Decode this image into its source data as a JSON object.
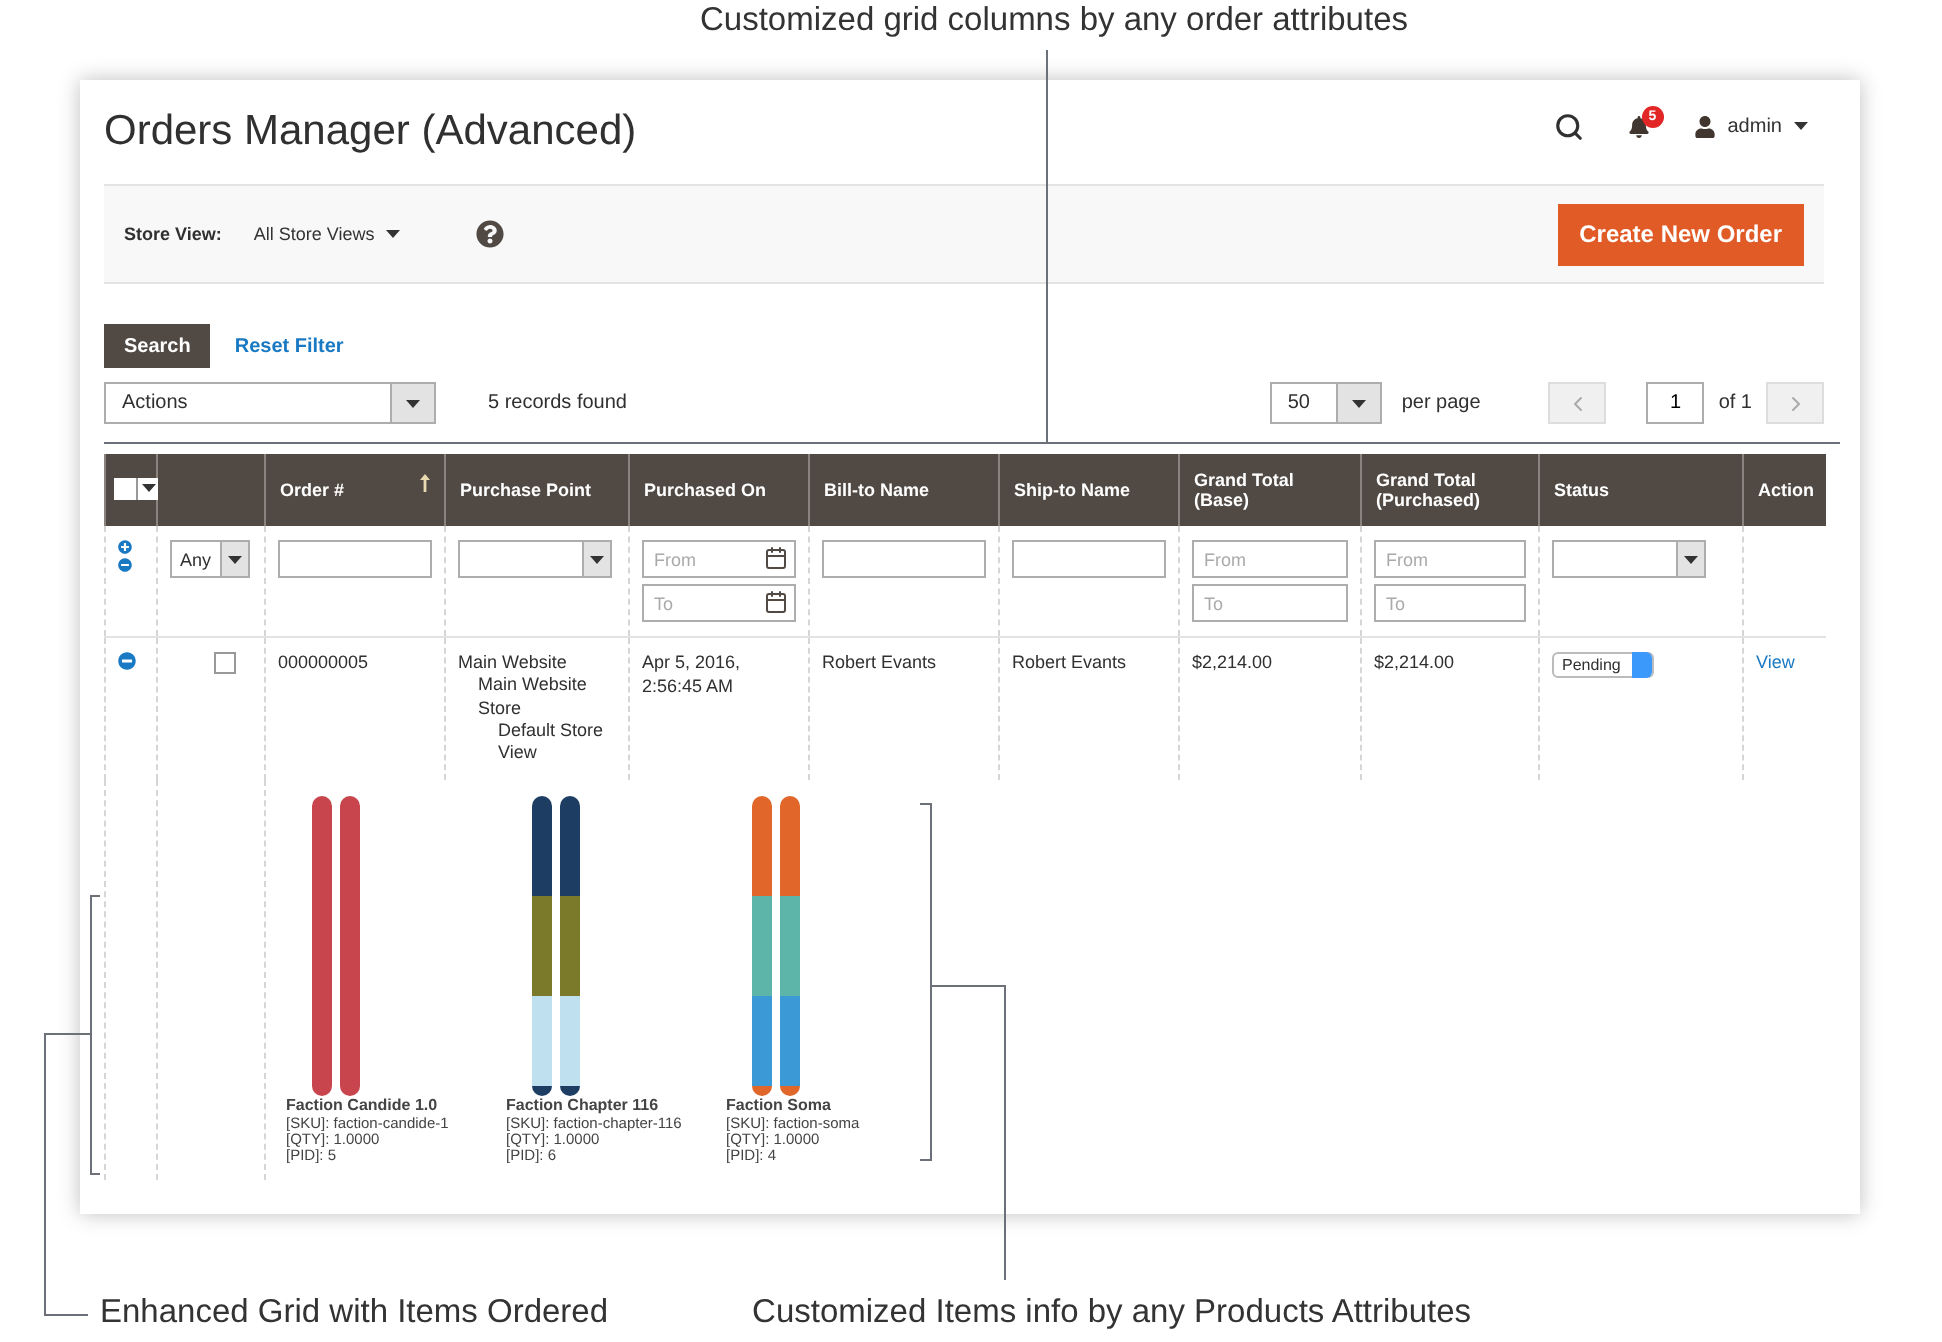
{
  "annotations": {
    "top": "Customized grid columns by any order attributes",
    "bottom_left": "Enhanced Grid with Items Ordered",
    "bottom_right": "Customized Items info by any Products Attributes"
  },
  "header": {
    "title": "Orders Manager (Advanced)",
    "notification_count": "5",
    "user": "admin"
  },
  "store_view": {
    "label": "Store View:",
    "value": "All Store Views"
  },
  "create_button": "Create New Order",
  "search_button": "Search",
  "reset_link": "Reset Filter",
  "actions_select": "Actions",
  "records": "5 records found",
  "pagination": {
    "per_page_value": "50",
    "per_page_label": "per page",
    "page": "1",
    "of": "of 1"
  },
  "table": {
    "columns": [
      {
        "kind": "mass"
      },
      {
        "kind": "blank"
      },
      {
        "kind": "text",
        "label": "Order #",
        "sorted": true
      },
      {
        "kind": "text",
        "label": "Purchase Point",
        "sorted": false
      },
      {
        "kind": "text",
        "label": "Purchased On",
        "sorted": false
      },
      {
        "kind": "text",
        "label": "Bill-to Name",
        "sorted": false
      },
      {
        "kind": "text",
        "label": "Ship-to Name",
        "sorted": false
      },
      {
        "kind": "text",
        "label": "Grand Total (Base)",
        "sorted": false
      },
      {
        "kind": "text",
        "label": "Grand Total (Purchased)",
        "sorted": false
      },
      {
        "kind": "text",
        "label": "Status",
        "sorted": false
      },
      {
        "kind": "text",
        "label": "Action",
        "sorted": false
      }
    ],
    "filters": [
      {
        "kind": "toggles"
      },
      {
        "kind": "select",
        "value": "Any"
      },
      {
        "kind": "text"
      },
      {
        "kind": "select"
      },
      {
        "kind": "date_range",
        "from_placeholder": "From",
        "to_placeholder": "To"
      },
      {
        "kind": "text"
      },
      {
        "kind": "text"
      },
      {
        "kind": "range",
        "from_placeholder": "From",
        "to_placeholder": "To"
      },
      {
        "kind": "range",
        "from_placeholder": "From",
        "to_placeholder": "To"
      },
      {
        "kind": "select"
      },
      {
        "kind": "none"
      }
    ],
    "rows": [
      {
        "expanded": true,
        "checked": false,
        "order": "000000005",
        "purchase_point": [
          {
            "text": "Main Website",
            "children": [
              {
                "text": "Main Website Store",
                "children": [
                  {
                    "text": "Default Store View"
                  }
                ]
              }
            ]
          }
        ],
        "purchased_on": "Apr 5, 2016, 2:56:45 AM",
        "bill_to": "Robert Evants",
        "ship_to": "Robert Evants",
        "total_base": "$2,214.00",
        "total_purchased": "$2,214.00",
        "status": "Pending",
        "action": "View",
        "items": [
          {
            "name": "Faction Candide 1.0",
            "sku": "[SKU]: faction-candide-1",
            "qty": "[QTY]: 1.0000",
            "pid": "[PID]: 5"
          },
          {
            "name": "Faction Chapter 116",
            "sku": "[SKU]: faction-chapter-116",
            "qty": "[QTY]: 1.0000",
            "pid": "[PID]: 6"
          },
          {
            "name": "Faction Soma",
            "sku": "[SKU]: faction-soma",
            "qty": "[QTY]: 1.0000",
            "pid": "[PID]: 4"
          }
        ]
      }
    ]
  }
}
